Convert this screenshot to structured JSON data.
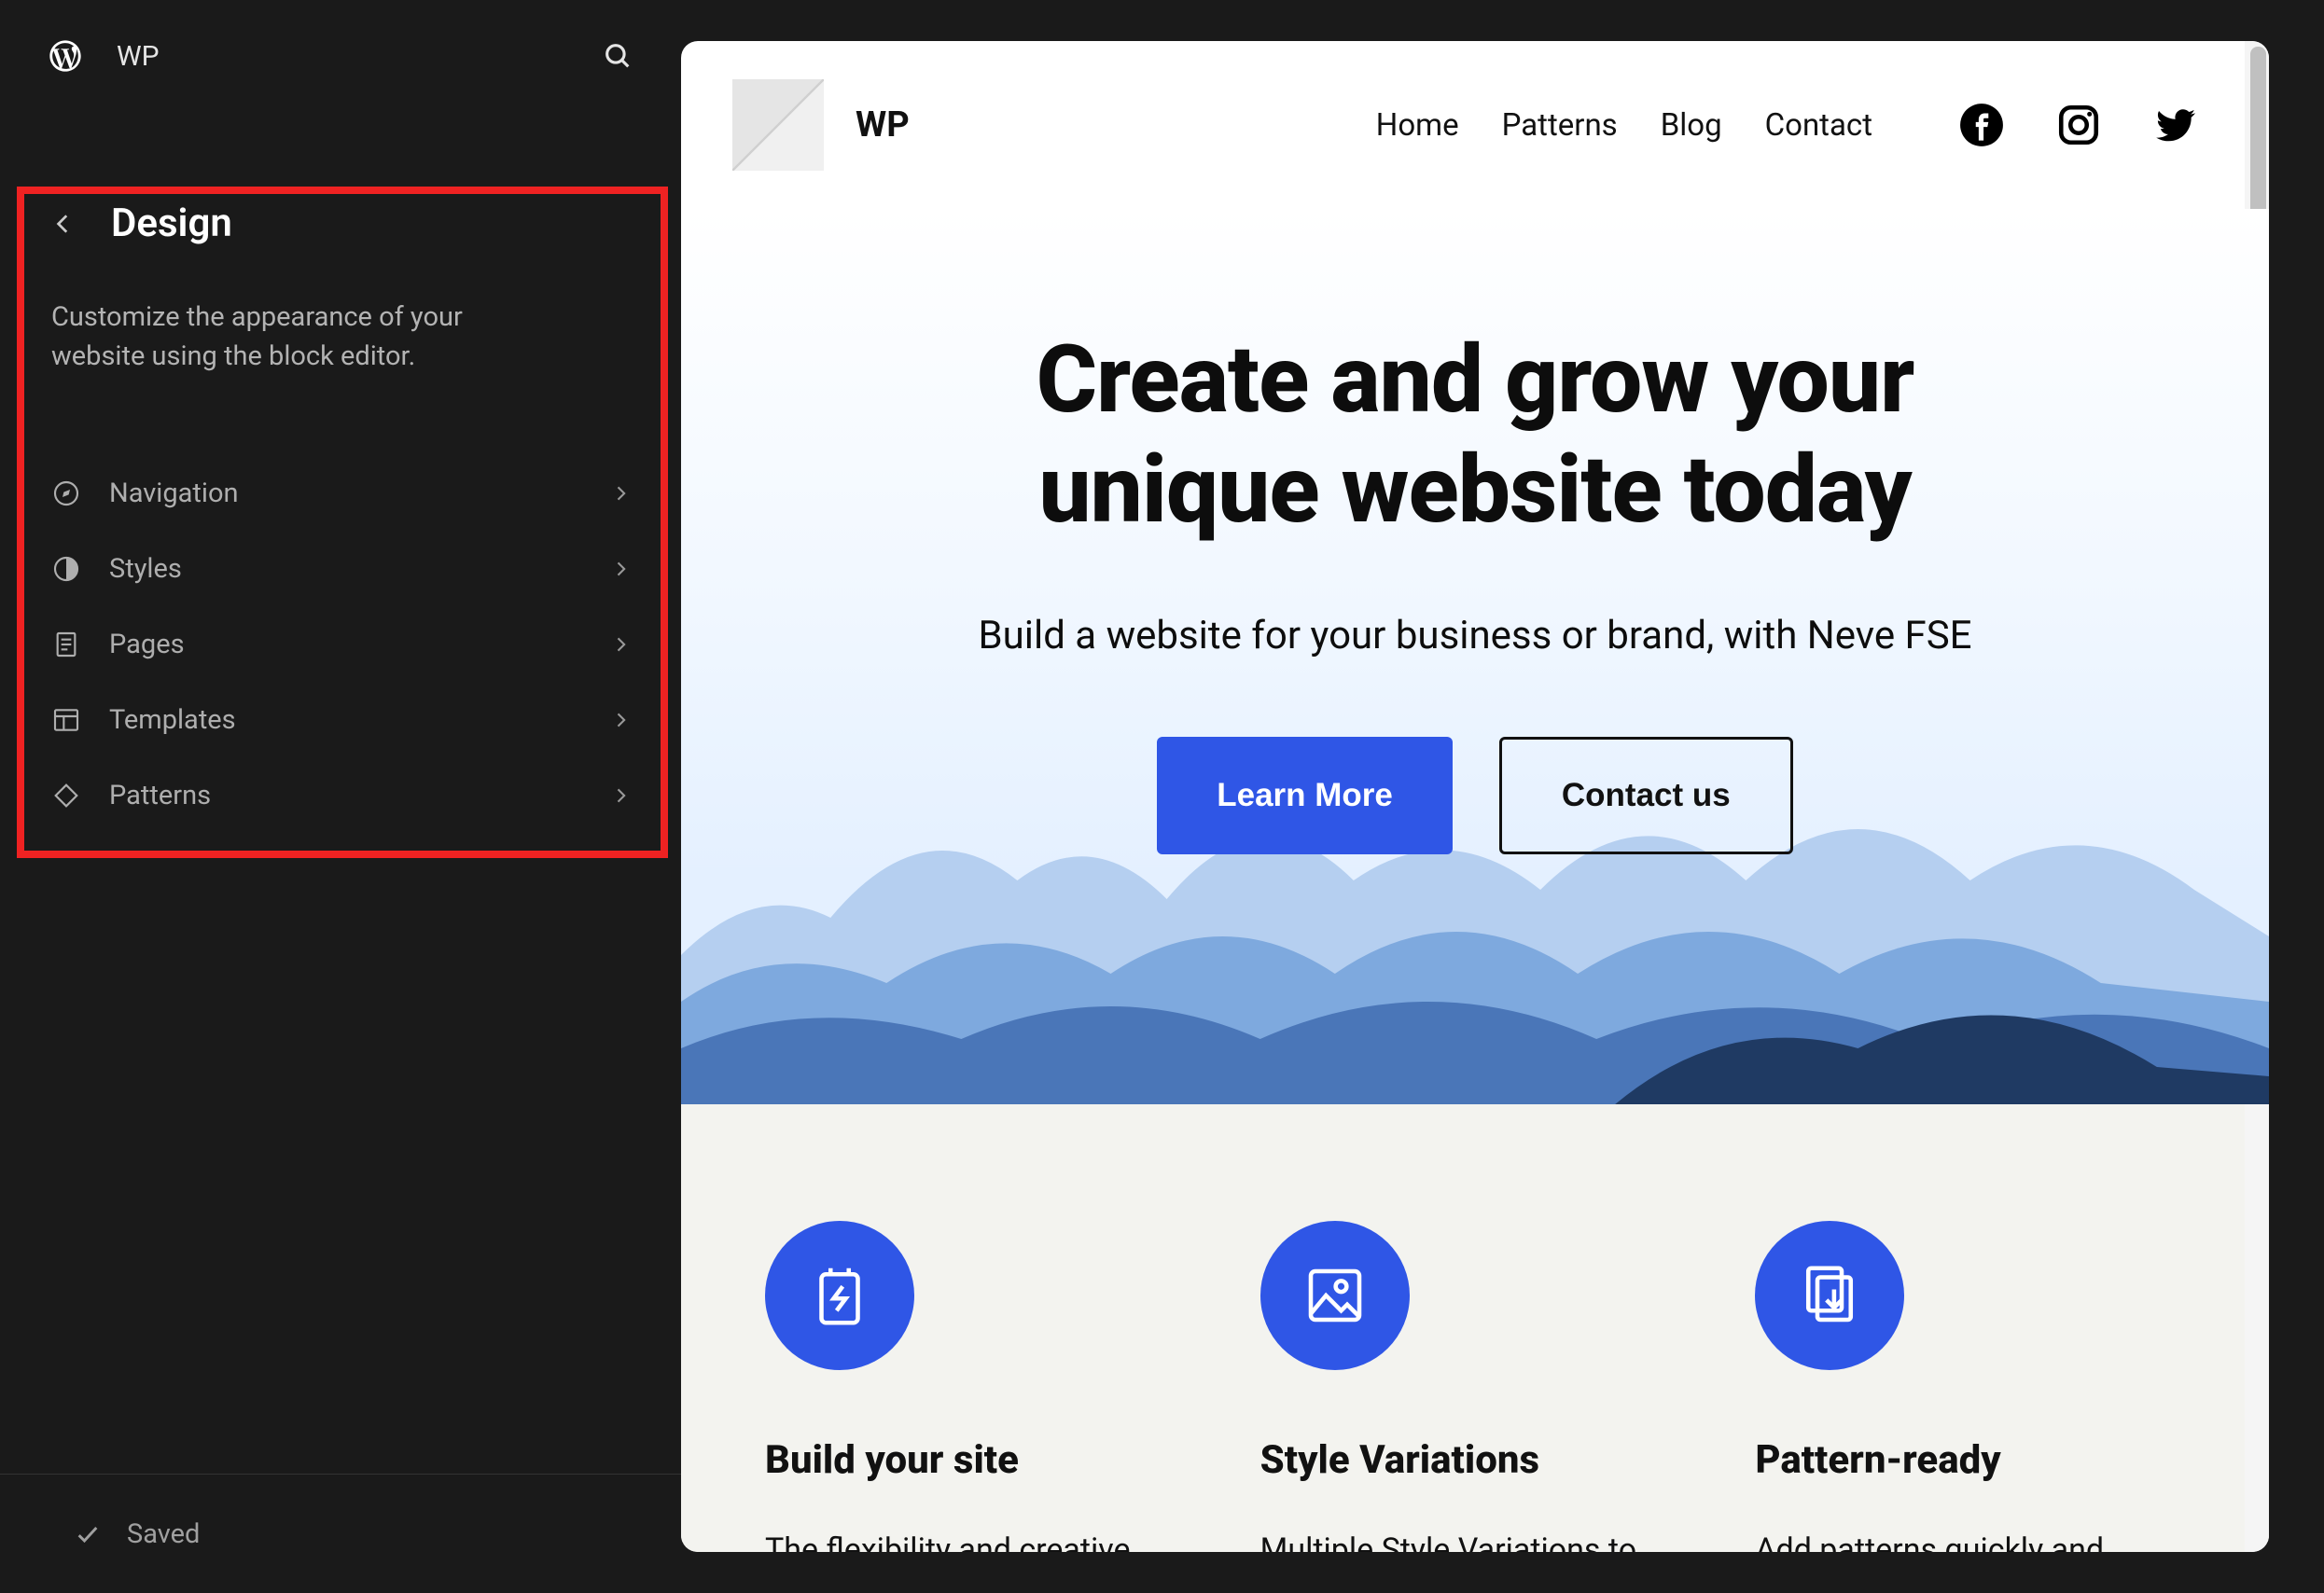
{
  "sidebar": {
    "site_name": "WP",
    "title": "Design",
    "description": "Customize the appearance of your website using the block editor.",
    "items": [
      {
        "label": "Navigation"
      },
      {
        "label": "Styles"
      },
      {
        "label": "Pages"
      },
      {
        "label": "Templates"
      },
      {
        "label": "Patterns"
      }
    ],
    "saved_label": "Saved"
  },
  "preview": {
    "site_title": "WP",
    "nav": [
      "Home",
      "Patterns",
      "Blog",
      "Contact"
    ],
    "hero_title": "Create and grow your unique website today",
    "hero_sub": "Build a website for your business or brand, with Neve FSE",
    "btn_primary": "Learn More",
    "btn_secondary": "Contact us",
    "features": [
      {
        "title": "Build your site",
        "text": "The flexibility and creative"
      },
      {
        "title": "Style Variations",
        "text": "Multiple Style Variations to"
      },
      {
        "title": "Pattern-ready",
        "text": "Add patterns quickly and"
      }
    ]
  }
}
